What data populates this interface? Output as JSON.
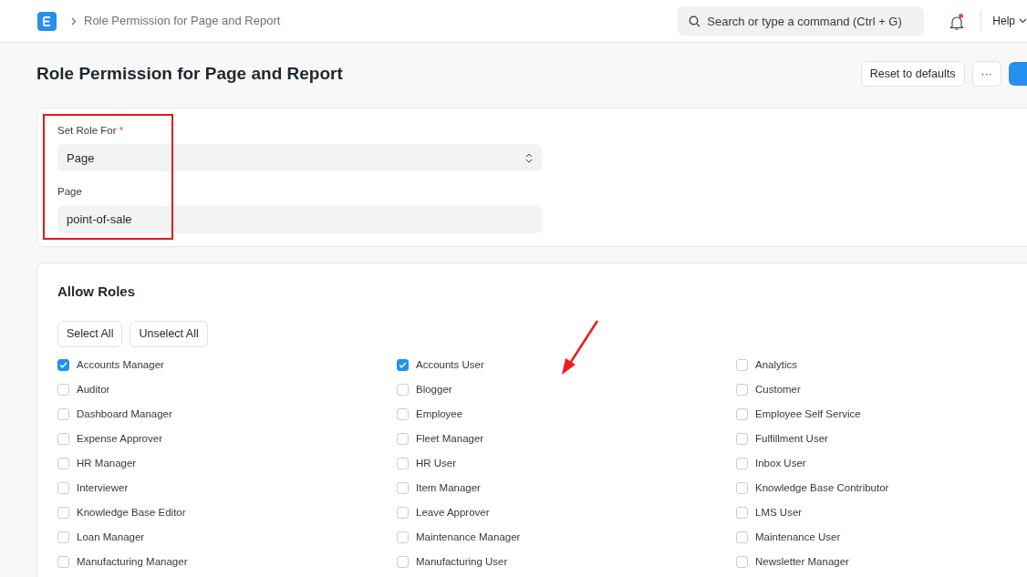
{
  "navbar": {
    "breadcrumb": "Role Permission for Page and Report",
    "search": {
      "placeholder": "Search or type a command (Ctrl + G)"
    },
    "notifications_unread": true,
    "help": "Help"
  },
  "page": {
    "title": "Role Permission for Page and Report",
    "actions": [
      "Reset to defaults",
      "···"
    ]
  },
  "form": {
    "highlighted": true,
    "fields": [
      {
        "label": "Set Role For",
        "required_mark": "*",
        "kind": "select",
        "value": "Page"
      },
      {
        "label": "Page",
        "kind": "text",
        "value": "point-of-sale"
      }
    ]
  },
  "roles": {
    "title": "Allow Roles",
    "buttons": [
      "Select All",
      "Unselect All"
    ],
    "items": [
      {
        "label": "Accounts Manager",
        "checked": true
      },
      {
        "label": "Accounts User",
        "checked": true
      },
      {
        "label": "Analytics",
        "checked": false
      },
      {
        "label": "Auditor",
        "checked": false
      },
      {
        "label": "Blogger",
        "checked": false
      },
      {
        "label": "Customer",
        "checked": false
      },
      {
        "label": "Dashboard Manager",
        "checked": false
      },
      {
        "label": "Employee",
        "checked": false
      },
      {
        "label": "Employee Self Service",
        "checked": false
      },
      {
        "label": "Expense Approver",
        "checked": false
      },
      {
        "label": "Fleet Manager",
        "checked": false
      },
      {
        "label": "Fulfillment User",
        "checked": false
      },
      {
        "label": "HR Manager",
        "checked": false
      },
      {
        "label": "HR User",
        "checked": false
      },
      {
        "label": "Inbox User",
        "checked": false
      },
      {
        "label": "Interviewer",
        "checked": false
      },
      {
        "label": "Item Manager",
        "checked": false
      },
      {
        "label": "Knowledge Base Contributor",
        "checked": false
      },
      {
        "label": "Knowledge Base Editor",
        "checked": false
      },
      {
        "label": "Leave Approver",
        "checked": false
      },
      {
        "label": "LMS User",
        "checked": false
      },
      {
        "label": "Loan Manager",
        "checked": false
      },
      {
        "label": "Maintenance Manager",
        "checked": false
      },
      {
        "label": "Maintenance User",
        "checked": false
      },
      {
        "label": "Manufacturing Manager",
        "checked": false
      },
      {
        "label": "Manufacturing User",
        "checked": false
      },
      {
        "label": "Newsletter Manager",
        "checked": false
      }
    ]
  }
}
